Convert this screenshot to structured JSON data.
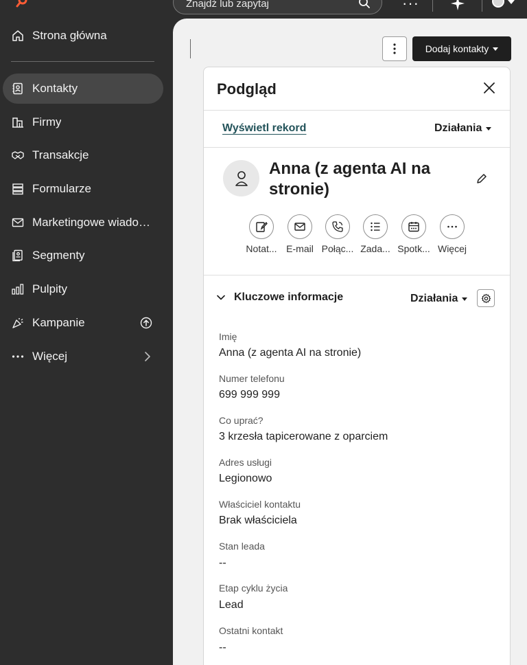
{
  "topbar": {
    "search_placeholder": "Znajdź lub zapytaj"
  },
  "sidebar": {
    "items": [
      {
        "label": "Strona główna",
        "icon": "home-icon"
      },
      {
        "label": "Kontakty",
        "icon": "contacts-icon",
        "active": true
      },
      {
        "label": "Firmy",
        "icon": "company-icon"
      },
      {
        "label": "Transakcje",
        "icon": "handshake-icon"
      },
      {
        "label": "Formularze",
        "icon": "form-icon"
      },
      {
        "label": "Marketingowe wiadom...",
        "icon": "mail-icon"
      },
      {
        "label": "Segmenty",
        "icon": "segment-icon"
      },
      {
        "label": "Pulpity",
        "icon": "dashboard-icon"
      },
      {
        "label": "Kampanie",
        "icon": "campaign-icon"
      },
      {
        "label": "Więcej",
        "icon": "more-icon"
      }
    ]
  },
  "main": {
    "add_contacts_label": "Dodaj kontakty"
  },
  "preview": {
    "title": "Podgląd",
    "view_record": "Wyświetl rekord",
    "actions": "Działania",
    "contact_name": "Anna (z agenta AI na stronie)",
    "quick_actions": [
      {
        "label": "Notat...",
        "icon": "note-icon"
      },
      {
        "label": "E-mail",
        "icon": "email-icon"
      },
      {
        "label": "Połąc...",
        "icon": "phone-icon"
      },
      {
        "label": "Zada...",
        "icon": "task-icon"
      },
      {
        "label": "Spotk...",
        "icon": "meeting-icon"
      },
      {
        "label": "Więcej",
        "icon": "more-icon"
      }
    ],
    "key_info": {
      "title": "Kluczowe informacje",
      "actions": "Działania",
      "fields": [
        {
          "label": "Imię",
          "value": "Anna (z agenta AI na stronie)"
        },
        {
          "label": "Numer telefonu",
          "value": "699 999 999"
        },
        {
          "label": "Co uprać?",
          "value": "3 krzesła tapicerowane z oparciem"
        },
        {
          "label": "Adres usługi",
          "value": "Legionowo"
        },
        {
          "label": "Właściciel kontaktu",
          "value": "Brak właściciela"
        },
        {
          "label": "Stan leada",
          "value": "--"
        },
        {
          "label": "Etap cyklu życia",
          "value": "Lead"
        },
        {
          "label": "Ostatni kontakt",
          "value": "--"
        }
      ]
    }
  },
  "colors": {
    "sidebar_bg": "#2d2d2d",
    "active_item": "#474747",
    "brand": "#ff5c35",
    "link": "#23535a"
  }
}
